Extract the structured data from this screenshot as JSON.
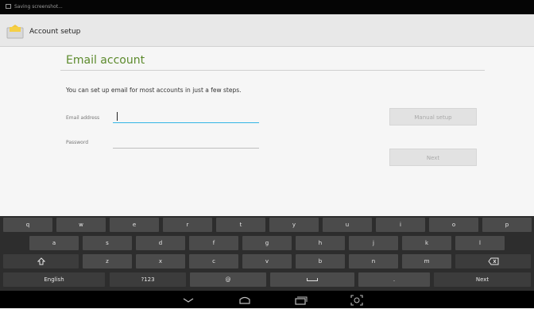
{
  "status_bar": {
    "notification": "Saving screenshot..."
  },
  "action_bar": {
    "title": "Account setup"
  },
  "main": {
    "heading": "Email account",
    "intro": "You can set up email for most accounts in just a few steps.",
    "email": {
      "label": "Email address",
      "value": ""
    },
    "password": {
      "label": "Password",
      "value": ""
    },
    "manual_setup_label": "Manual setup",
    "next_label": "Next"
  },
  "keyboard": {
    "row1": [
      "q",
      "w",
      "e",
      "r",
      "t",
      "y",
      "u",
      "i",
      "o",
      "p"
    ],
    "row2": [
      "a",
      "s",
      "d",
      "f",
      "g",
      "h",
      "j",
      "k",
      "l"
    ],
    "row3": [
      "z",
      "x",
      "c",
      "v",
      "b",
      "n",
      "m"
    ],
    "language": "English",
    "symbols": "?123",
    "at": "@",
    "period": ".",
    "next": "Next"
  },
  "colors": {
    "accent": "#33b5e5",
    "heading": "#5c8a2c",
    "key": "#4b4b4b",
    "keyboard_bg": "#2d2d2d"
  }
}
